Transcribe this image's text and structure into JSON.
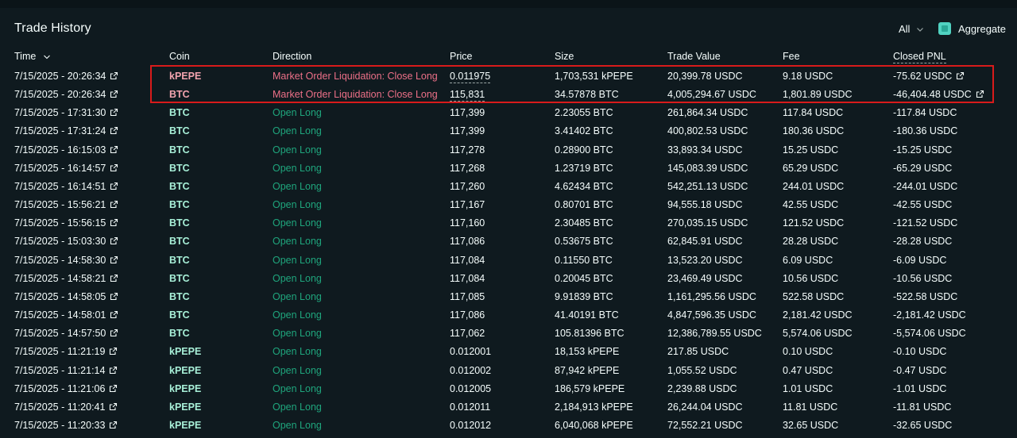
{
  "panel": {
    "title": "Trade History",
    "filter_label": "All",
    "aggregate_label": "Aggregate"
  },
  "columns": {
    "time": "Time",
    "coin": "Coin",
    "direction": "Direction",
    "price": "Price",
    "size": "Size",
    "trade_value": "Trade Value",
    "fee": "Fee",
    "closed_pnl": "Closed PNL"
  },
  "colors": {
    "background": "#0f1a1f",
    "open_long": "#1fa67d",
    "liquidation": "#ed7088",
    "coin_green": "#a8f0d8",
    "coin_red": "#f2a3ae",
    "highlight_box": "#d81b1b",
    "accent": "#50d2c1"
  },
  "rows": [
    {
      "time": "7/15/2025 - 20:26:34",
      "coin": "kPEPE",
      "direction": "Market Order Liquidation: Close Long",
      "price": "0.011975",
      "size": "1,703,531 kPEPE",
      "value": "20,399.78 USDC",
      "fee": "9.18 USDC",
      "pnl": "-75.62 USDC",
      "liq": true
    },
    {
      "time": "7/15/2025 - 20:26:34",
      "coin": "BTC",
      "direction": "Market Order Liquidation: Close Long",
      "price": "115,831",
      "size": "34.57878 BTC",
      "value": "4,005,294.67 USDC",
      "fee": "1,801.89 USDC",
      "pnl": "-46,404.48 USDC",
      "liq": true
    },
    {
      "time": "7/15/2025 - 17:31:30",
      "coin": "BTC",
      "direction": "Open Long",
      "price": "117,399",
      "size": "2.23055 BTC",
      "value": "261,864.34 USDC",
      "fee": "117.84 USDC",
      "pnl": "-117.84 USDC",
      "liq": false
    },
    {
      "time": "7/15/2025 - 17:31:24",
      "coin": "BTC",
      "direction": "Open Long",
      "price": "117,399",
      "size": "3.41402 BTC",
      "value": "400,802.53 USDC",
      "fee": "180.36 USDC",
      "pnl": "-180.36 USDC",
      "liq": false
    },
    {
      "time": "7/15/2025 - 16:15:03",
      "coin": "BTC",
      "direction": "Open Long",
      "price": "117,278",
      "size": "0.28900 BTC",
      "value": "33,893.34 USDC",
      "fee": "15.25 USDC",
      "pnl": "-15.25 USDC",
      "liq": false
    },
    {
      "time": "7/15/2025 - 16:14:57",
      "coin": "BTC",
      "direction": "Open Long",
      "price": "117,268",
      "size": "1.23719 BTC",
      "value": "145,083.39 USDC",
      "fee": "65.29 USDC",
      "pnl": "-65.29 USDC",
      "liq": false
    },
    {
      "time": "7/15/2025 - 16:14:51",
      "coin": "BTC",
      "direction": "Open Long",
      "price": "117,260",
      "size": "4.62434 BTC",
      "value": "542,251.13 USDC",
      "fee": "244.01 USDC",
      "pnl": "-244.01 USDC",
      "liq": false
    },
    {
      "time": "7/15/2025 - 15:56:21",
      "coin": "BTC",
      "direction": "Open Long",
      "price": "117,167",
      "size": "0.80701 BTC",
      "value": "94,555.18 USDC",
      "fee": "42.55 USDC",
      "pnl": "-42.55 USDC",
      "liq": false
    },
    {
      "time": "7/15/2025 - 15:56:15",
      "coin": "BTC",
      "direction": "Open Long",
      "price": "117,160",
      "size": "2.30485 BTC",
      "value": "270,035.15 USDC",
      "fee": "121.52 USDC",
      "pnl": "-121.52 USDC",
      "liq": false
    },
    {
      "time": "7/15/2025 - 15:03:30",
      "coin": "BTC",
      "direction": "Open Long",
      "price": "117,086",
      "size": "0.53675 BTC",
      "value": "62,845.91 USDC",
      "fee": "28.28 USDC",
      "pnl": "-28.28 USDC",
      "liq": false
    },
    {
      "time": "7/15/2025 - 14:58:30",
      "coin": "BTC",
      "direction": "Open Long",
      "price": "117,084",
      "size": "0.11550 BTC",
      "value": "13,523.20 USDC",
      "fee": "6.09 USDC",
      "pnl": "-6.09 USDC",
      "liq": false
    },
    {
      "time": "7/15/2025 - 14:58:21",
      "coin": "BTC",
      "direction": "Open Long",
      "price": "117,084",
      "size": "0.20045 BTC",
      "value": "23,469.49 USDC",
      "fee": "10.56 USDC",
      "pnl": "-10.56 USDC",
      "liq": false
    },
    {
      "time": "7/15/2025 - 14:58:05",
      "coin": "BTC",
      "direction": "Open Long",
      "price": "117,085",
      "size": "9.91839 BTC",
      "value": "1,161,295.56 USDC",
      "fee": "522.58 USDC",
      "pnl": "-522.58 USDC",
      "liq": false
    },
    {
      "time": "7/15/2025 - 14:58:01",
      "coin": "BTC",
      "direction": "Open Long",
      "price": "117,086",
      "size": "41.40191 BTC",
      "value": "4,847,596.35 USDC",
      "fee": "2,181.42 USDC",
      "pnl": "-2,181.42 USDC",
      "liq": false
    },
    {
      "time": "7/15/2025 - 14:57:50",
      "coin": "BTC",
      "direction": "Open Long",
      "price": "117,062",
      "size": "105.81396 BTC",
      "value": "12,386,789.55 USDC",
      "fee": "5,574.06 USDC",
      "pnl": "-5,574.06 USDC",
      "liq": false
    },
    {
      "time": "7/15/2025 - 11:21:19",
      "coin": "kPEPE",
      "direction": "Open Long",
      "price": "0.012001",
      "size": "18,153 kPEPE",
      "value": "217.85 USDC",
      "fee": "0.10 USDC",
      "pnl": "-0.10 USDC",
      "liq": false
    },
    {
      "time": "7/15/2025 - 11:21:14",
      "coin": "kPEPE",
      "direction": "Open Long",
      "price": "0.012002",
      "size": "87,942 kPEPE",
      "value": "1,055.52 USDC",
      "fee": "0.47 USDC",
      "pnl": "-0.47 USDC",
      "liq": false
    },
    {
      "time": "7/15/2025 - 11:21:06",
      "coin": "kPEPE",
      "direction": "Open Long",
      "price": "0.012005",
      "size": "186,579 kPEPE",
      "value": "2,239.88 USDC",
      "fee": "1.01 USDC",
      "pnl": "-1.01 USDC",
      "liq": false
    },
    {
      "time": "7/15/2025 - 11:20:41",
      "coin": "kPEPE",
      "direction": "Open Long",
      "price": "0.012011",
      "size": "2,184,913 kPEPE",
      "value": "26,244.04 USDC",
      "fee": "11.81 USDC",
      "pnl": "-11.81 USDC",
      "liq": false
    },
    {
      "time": "7/15/2025 - 11:20:33",
      "coin": "kPEPE",
      "direction": "Open Long",
      "price": "0.012012",
      "size": "6,040,068 kPEPE",
      "value": "72,552.21 USDC",
      "fee": "32.65 USDC",
      "pnl": "-32.65 USDC",
      "liq": false
    }
  ]
}
